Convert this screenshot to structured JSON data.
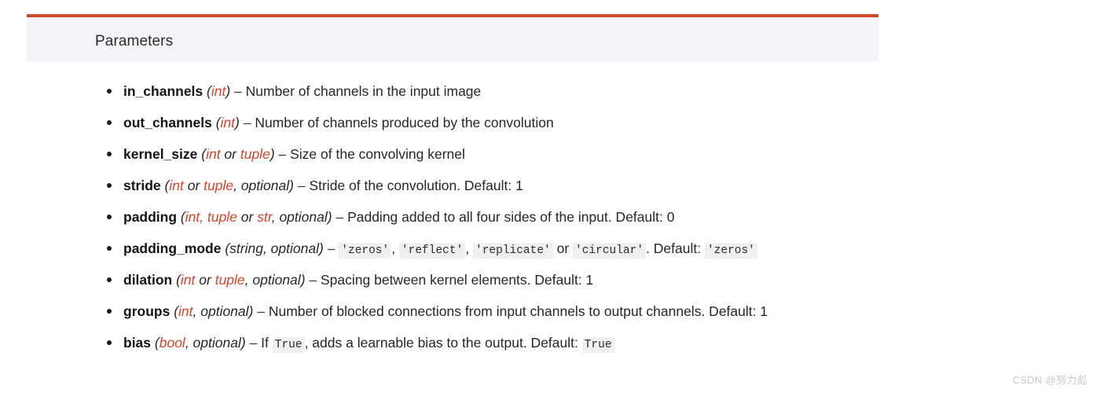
{
  "panel": {
    "title": "Parameters",
    "accent_color": "#cc4b2c",
    "background_color": "#f3f4f7"
  },
  "theme": {
    "type_color": "#d9412a",
    "text_color": "#262626",
    "code_background": "#f0f0f0",
    "page_background": "#ffffff"
  },
  "parameters": [
    {
      "name": "in_channels",
      "open_paren": "(",
      "type_red": "int",
      "type_tail": "",
      "close_paren": ")",
      "dash": "–",
      "desc_before": "Number of channels in the input image",
      "code1": "",
      "desc_mid": "",
      "code2": "",
      "desc_after": ""
    },
    {
      "name": "out_channels",
      "open_paren": "(",
      "type_red": "int",
      "type_tail": "",
      "close_paren": ")",
      "dash": "–",
      "desc_before": "Number of channels produced by the convolution",
      "code1": "",
      "desc_mid": "",
      "code2": "",
      "desc_after": ""
    },
    {
      "name": "kernel_size",
      "open_paren": "(",
      "type_red": "int",
      "type_tail": " or ",
      "type_red2": "tuple",
      "close_paren": ")",
      "dash": "–",
      "desc_before": "Size of the convolving kernel",
      "code1": "",
      "desc_mid": "",
      "code2": "",
      "desc_after": ""
    },
    {
      "name": "stride",
      "open_paren": "(",
      "type_red": "int",
      "type_tail": " or ",
      "type_red2": "tuple",
      "type_optional": ", optional",
      "close_paren": ")",
      "dash": "–",
      "desc_before": "Stride of the convolution. Default: 1",
      "code1": "",
      "desc_mid": "",
      "code2": "",
      "desc_after": ""
    },
    {
      "name": "padding",
      "open_paren": "(",
      "type_red": "int,",
      "type_tail": " ",
      "type_red2": "tuple",
      "type_mid": " or ",
      "type_red3": "str",
      "type_optional": ", optional",
      "close_paren": ")",
      "dash": "–",
      "desc_before": "Padding added to all four sides of the input. Default: 0",
      "code1": "",
      "desc_mid": "",
      "code2": "",
      "desc_after": ""
    },
    {
      "name": "padding_mode",
      "open_paren": "(",
      "type_plain": "string, optional",
      "close_paren": ")",
      "dash": "–",
      "desc_before": "",
      "code1": "'zeros'",
      "sep1": ", ",
      "code2": "'reflect'",
      "sep2": ", ",
      "code3": "'replicate'",
      "sep3": " or ",
      "code4": "'circular'",
      "desc_after": ". Default: ",
      "code5": "'zeros'"
    },
    {
      "name": "dilation",
      "open_paren": "(",
      "type_red": "int",
      "type_tail": " or ",
      "type_red2": "tuple",
      "type_optional": ", optional",
      "close_paren": ")",
      "dash": "–",
      "desc_before": "Spacing between kernel elements. Default: 1",
      "code1": "",
      "desc_mid": "",
      "code2": "",
      "desc_after": ""
    },
    {
      "name": "groups",
      "open_paren": "(",
      "type_red": "int",
      "type_optional": ", optional",
      "close_paren": ")",
      "dash": "–",
      "desc_before": "Number of blocked connections from input channels to output channels. Default: 1",
      "code1": "",
      "desc_mid": "",
      "code2": "",
      "desc_after": ""
    },
    {
      "name": "bias",
      "open_paren": "(",
      "type_red": "bool",
      "type_optional": ", optional",
      "close_paren": ")",
      "dash": "–",
      "desc_before": "If ",
      "code1": "True",
      "desc_mid": ", adds a learnable bias to the output. Default: ",
      "code2": "True",
      "desc_after": ""
    }
  ],
  "watermark": {
    "text": "CSDN @努力彪"
  }
}
